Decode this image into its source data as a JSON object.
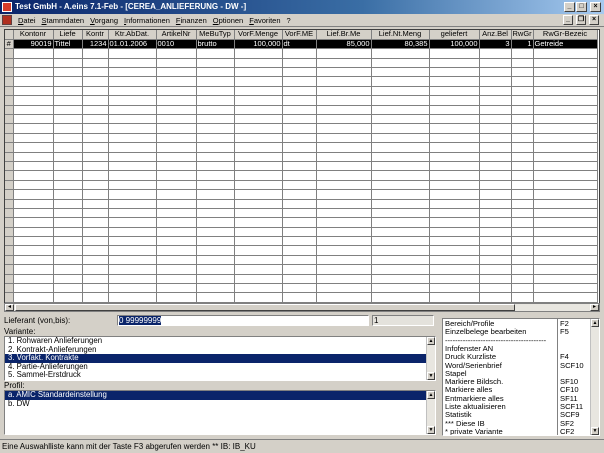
{
  "window": {
    "title": "Test GmbH - A.eins 7.1-Feb - [CEREA_ANLIEFERUNG - DW -]"
  },
  "menu": [
    "Datei",
    "Stammdaten",
    "Vorgang",
    "Informationen",
    "Finanzen",
    "Optionen",
    "Favoriten",
    "?"
  ],
  "grid": {
    "columns": [
      "Kontonr",
      "Liefe",
      "Kontr",
      "Ktr.AbDat.",
      "ArtikelNr",
      "MeBuTyp",
      "VorF.Menge",
      "VorF.ME",
      "Lief.Br.Me",
      "Lief.Nt.Meng",
      "geliefert",
      "Anz.Bel",
      "RwGr",
      "RwGr-Bezeic"
    ],
    "rows": [
      [
        "90019",
        "Tittel",
        "1234",
        "01.01.2006",
        "0010",
        "brutto",
        "100,000",
        "dt",
        "85,000",
        "80,385",
        "100,000",
        "3",
        "1",
        "Getreide"
      ]
    ],
    "empty_row_count": 27,
    "row_indicator": "#"
  },
  "lieferant": {
    "label": "Lieferant (von,bis):",
    "from": "0 99999999",
    "to": "1"
  },
  "variante": {
    "label": "Variante:",
    "items": [
      "1.  Rohwaren Anlieferungen",
      "2.  Kontrakt-Anlieferungen",
      "3.  Vorfakt. Kontrakte",
      "4.  Partie-Anlieferungen",
      "5.  Sammel-Erstdruck"
    ],
    "selected_index": 2
  },
  "profil": {
    "label": "Profil:",
    "items": [
      "a. AMIC Standardeinstellung",
      "b. DW"
    ],
    "selected_index": 0
  },
  "shortcuts": [
    {
      "label": "Bereich/Profile",
      "key": "F2"
    },
    {
      "label": "Einzelbelege bearbeiten",
      "key": "F5"
    },
    {
      "label": "----------------------------------------",
      "key": ""
    },
    {
      "label": "Infofenster AN",
      "key": ""
    },
    {
      "label": "Druck Kurzliste",
      "key": "F4"
    },
    {
      "label": "Word/Serienbrief",
      "key": "SCF10"
    },
    {
      "label": "Stapel",
      "key": ""
    },
    {
      "label": "Markiere Bildsch.",
      "key": "SF10"
    },
    {
      "label": "Markiere alles",
      "key": "CF10"
    },
    {
      "label": "Entmarkiere alles",
      "key": "SF11"
    },
    {
      "label": "Liste aktualisieren",
      "key": "SCF11"
    },
    {
      "label": "Statistik",
      "key": "SCF9"
    },
    {
      "label": "*** Diese IB",
      "key": "SF2"
    },
    {
      "label": "* private Variante",
      "key": "CF2"
    }
  ],
  "status": {
    "text": "Eine Auswahlliste kann mit der Taste F3 abgerufen werden ** IB: IB_KU"
  }
}
